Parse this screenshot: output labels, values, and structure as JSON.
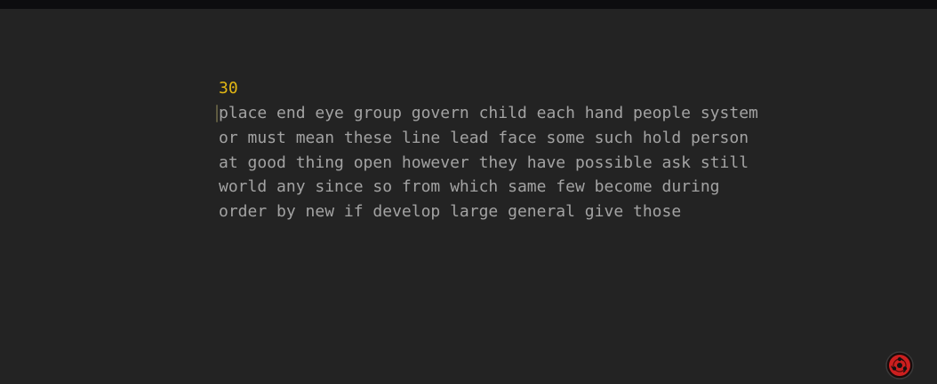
{
  "timer": "30",
  "words": {
    "lines": [
      "place end eye group govern child each hand people system",
      "or must mean these line lead face some such hold person",
      "at good thing open however they have possible ask still",
      "world any since so from which same few become during",
      "order by new if develop large general give those"
    ]
  },
  "colors": {
    "background": "#232323",
    "top_bar": "#0d0d0f",
    "timer": "#e2b714",
    "text": "#a3a3a3",
    "caret": "#5e5a40",
    "logo": "#cc1f1f"
  },
  "icons": {
    "logo": "sharingan-icon"
  }
}
